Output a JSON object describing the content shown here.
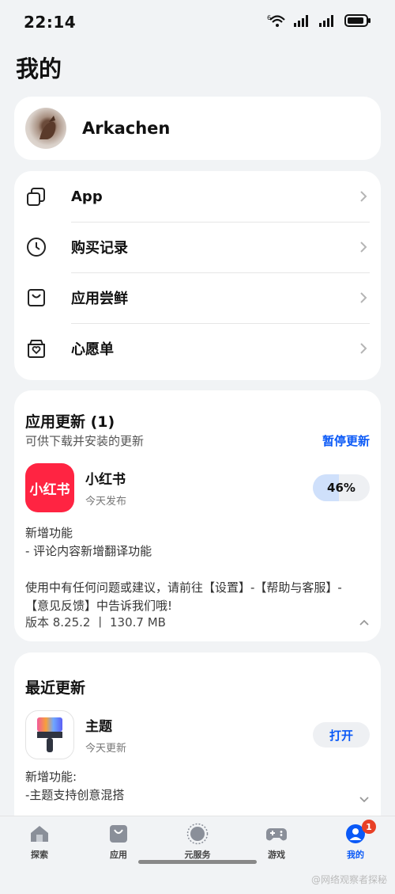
{
  "status": {
    "time": "22:14",
    "wifi_label": "6"
  },
  "page": {
    "title": "我的"
  },
  "profile": {
    "name": "Arkachen"
  },
  "menu": [
    {
      "label": "App",
      "icon": "apps-icon"
    },
    {
      "label": "购买记录",
      "icon": "clock-icon"
    },
    {
      "label": "应用尝鲜",
      "icon": "bag-icon"
    },
    {
      "label": "心愿单",
      "icon": "heart-box-icon"
    }
  ],
  "updates": {
    "title": "应用更新 (1)",
    "subtitle": "可供下载并安装的更新",
    "pause_label": "暂停更新",
    "app": {
      "icon_text": "小红书",
      "name": "小红书",
      "date": "今天发布",
      "progress_text": "46%",
      "progress": 0.46
    },
    "notes": [
      "新增功能",
      "- 评论内容新增翻译功能",
      "",
      "使用中有任何问题或建议，请前往【设置】-【帮助与客服】-",
      "【意见反馈】中告诉我们哦!"
    ],
    "version": "版本 8.25.2 丨 130.7 MB"
  },
  "recent": {
    "title": "最近更新",
    "app": {
      "name": "主题",
      "date": "今天更新",
      "open_label": "打开"
    },
    "notes": [
      "新增功能:",
      "-主题支持创意混搭"
    ]
  },
  "tabs": [
    {
      "label": "探索",
      "icon": "home-icon"
    },
    {
      "label": "应用",
      "icon": "bag-icon"
    },
    {
      "label": "元服务",
      "icon": "sun-icon"
    },
    {
      "label": "游戏",
      "icon": "gamepad-icon"
    },
    {
      "label": "我的",
      "icon": "user-icon",
      "badge": "1",
      "active": true
    }
  ],
  "watermark": "@网络观察者探秘"
}
